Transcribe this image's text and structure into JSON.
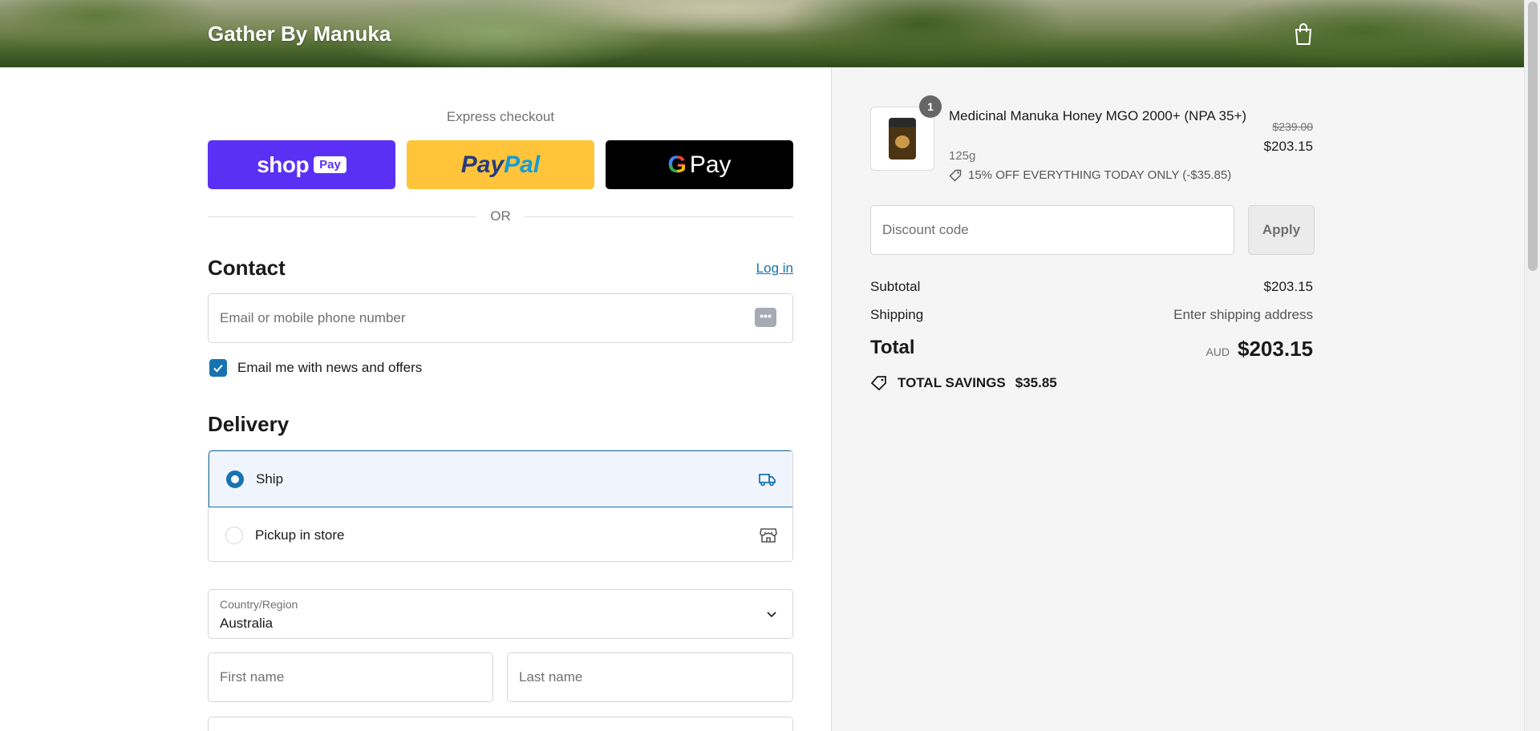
{
  "header": {
    "brand": "Gather By Manuka"
  },
  "express": {
    "title": "Express checkout",
    "shop_label": "shop",
    "shop_pay_tag": "Pay",
    "paypal_label_1": "Pay",
    "paypal_label_2": "Pal",
    "gpay_g": "G",
    "gpay_label": "Pay",
    "or_text": "OR"
  },
  "contact": {
    "title": "Contact",
    "login_label": "Log in",
    "email_placeholder": "Email or mobile phone number",
    "autofill_glyph": "•••",
    "newsletter_label": "Email me with news and offers",
    "newsletter_checked": true
  },
  "delivery": {
    "title": "Delivery",
    "options": [
      {
        "label": "Ship",
        "selected": true,
        "icon": "truck-icon"
      },
      {
        "label": "Pickup in store",
        "selected": false,
        "icon": "store-icon"
      }
    ],
    "country_label": "Country/Region",
    "country_value": "Australia",
    "first_name_placeholder": "First name",
    "last_name_placeholder": "Last name"
  },
  "summary": {
    "item": {
      "quantity": "1",
      "name": "Medicinal Manuka Honey MGO 2000+ (NPA 35+)",
      "variant": "125g",
      "discount_text": "15% OFF EVERYTHING TODAY ONLY (-$35.85)",
      "original_price": "$239.00",
      "price": "$203.15"
    },
    "discount_placeholder": "Discount code",
    "apply_label": "Apply",
    "subtotal_label": "Subtotal",
    "subtotal_value": "$203.15",
    "shipping_label": "Shipping",
    "shipping_value": "Enter shipping address",
    "total_label": "Total",
    "currency": "AUD",
    "total_value": "$203.15",
    "savings_label": "TOTAL SAVINGS",
    "savings_value": "$35.85"
  },
  "colors": {
    "accent": "#1773b0",
    "shop_pay": "#5a31f4",
    "paypal": "#ffc439",
    "gpay": "#000000"
  }
}
